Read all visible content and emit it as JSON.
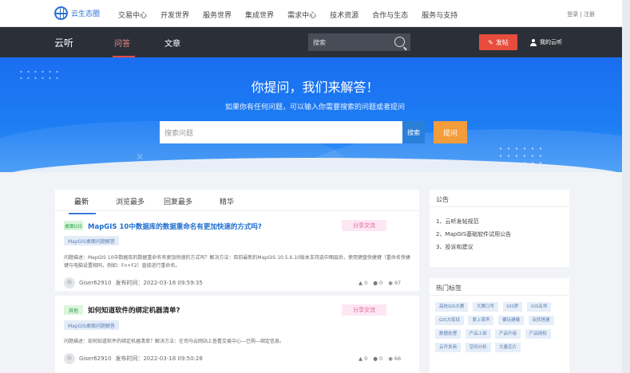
{
  "site": {
    "logo": "云生态圈",
    "nav": [
      "交易中心",
      "开发世界",
      "服务世界",
      "集成世界",
      "需求中心",
      "技术资源",
      "合作与生态",
      "服务与支持"
    ],
    "auth": "登录 | 注册"
  },
  "community": {
    "brand": "云听",
    "tabs": [
      "问答",
      "文章"
    ],
    "search_placeholder": "搜索",
    "post_button": "发帖",
    "my_cloud": "我的云听"
  },
  "hero": {
    "title": "你提问，我们来解答！",
    "subtitle": "如果你有任何问题，可以输入你需要搜索的问题或者提问",
    "input_placeholder": "搜索问题",
    "search_button": "搜索",
    "ask_button": "提问"
  },
  "list": {
    "tabs": [
      "最新",
      "浏览最多",
      "回复最多",
      "精华"
    ],
    "questions": [
      {
        "category": "桌面GIS",
        "title": "MapGIS 10中数据库的数据重命名有更加快速的方式吗?",
        "badge": "分享交流",
        "tag": "MapGIS桌面问题解答",
        "description": "问题描述：MapGIS 10中数据库的数据重命名有更加快速的方式吗？解决方法：目前最新的MapGIS 10.5.6.10版本支持选中图层后，使用键盘快捷键（重命名快捷键与电脑设置相同，例如：Fn+F2）直接进行重命名。",
        "author": "Giser62910",
        "time": "发布时间：2022-03-18 09:59:35",
        "likes": "0",
        "comments": "0",
        "views": "97"
      },
      {
        "category": "其他",
        "title": "如何知道软件的绑定机器清单?",
        "badge": "分享交流",
        "tag": "MapGIS桌面问题解答",
        "description": "问题描述：如何知道软件的绑定机器清单？解决方法：在司马云网站上查看交易中心—已购—绑定信息。",
        "author": "Giser62910",
        "time": "发布时间：2022-03-18 09:50:28",
        "likes": "0",
        "comments": "0",
        "views": "66"
      }
    ]
  },
  "sidebar": {
    "announcement_title": "公告",
    "announcements": [
      "1、云听发帖规范",
      "2、MapGIS基础软件试用公告",
      "3、投诉和建议"
    ],
    "hot_tags_title": "热门标签",
    "hot_tags": [
      "高校GIS大赛",
      "大赛口号",
      "GIS梦",
      "GIS名师",
      "GIS大炼狱",
      "爱上掌声",
      "要玩建模",
      "玩转搭建",
      "数据处理",
      "产品上架",
      "产品升级",
      "产品授权",
      "云开发商",
      "空间分析",
      "大量瓦片"
    ]
  },
  "colors": {
    "brand_blue": "#1a6ef0",
    "dark_bar": "#2b3038",
    "post_red": "#e74c3c",
    "ask_orange": "#f39c3c",
    "link_blue": "#1c6dd0"
  }
}
